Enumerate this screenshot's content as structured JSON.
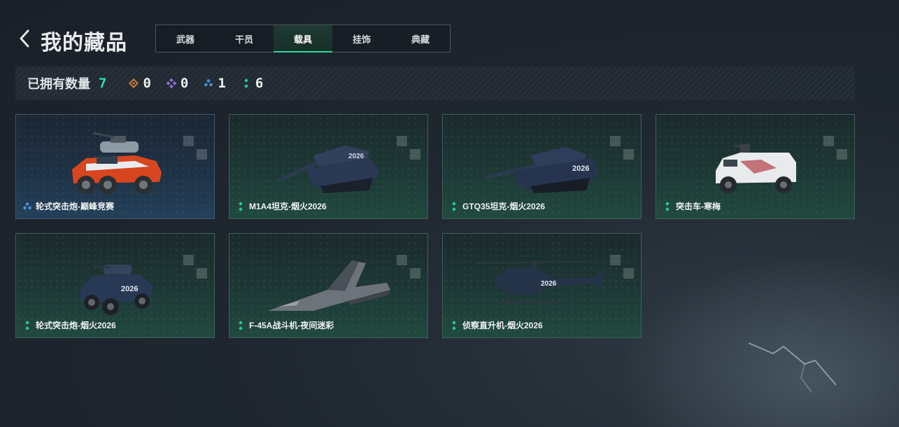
{
  "header": {
    "title": "我的藏品",
    "tabs": [
      {
        "label": "武器",
        "active": false
      },
      {
        "label": "干员",
        "active": false
      },
      {
        "label": "载具",
        "active": true
      },
      {
        "label": "挂饰",
        "active": false
      },
      {
        "label": "典藏",
        "active": false
      }
    ]
  },
  "stats": {
    "label": "已拥有数量",
    "total": "7",
    "rarities": [
      {
        "icon": "orange-diamond-icon",
        "color": "#c77a3a",
        "count": "0"
      },
      {
        "icon": "purple-diamond-icon",
        "color": "#8a6fd6",
        "count": "0"
      },
      {
        "icon": "blue-diamond-icon",
        "color": "#4a8fd8",
        "count": "1"
      },
      {
        "icon": "green-diamond-icon",
        "color": "#27c98e",
        "count": "6"
      }
    ]
  },
  "items": [
    {
      "name": "轮式突击炮-巅峰竞赛",
      "rarity": "blue",
      "icon": "wheeled-assault-gun-icon"
    },
    {
      "name": "M1A4坦克-烟火2026",
      "rarity": "green",
      "icon": "tank-icon"
    },
    {
      "name": "GTQ35坦克-烟火2026",
      "rarity": "green",
      "icon": "tank-icon"
    },
    {
      "name": "突击车-寒梅",
      "rarity": "green",
      "icon": "assault-vehicle-icon"
    },
    {
      "name": "轮式突击炮-烟火2026",
      "rarity": "green",
      "icon": "wheeled-assault-gun-icon"
    },
    {
      "name": "F-45A战斗机-夜间迷彩",
      "rarity": "green",
      "icon": "fighter-jet-icon"
    },
    {
      "name": "侦察直升机-烟火2026",
      "rarity": "green",
      "icon": "helicopter-icon"
    }
  ],
  "colors": {
    "accent": "#27d79a",
    "blue_rarity": "#4a8fd8",
    "green_rarity": "#27c98e"
  }
}
